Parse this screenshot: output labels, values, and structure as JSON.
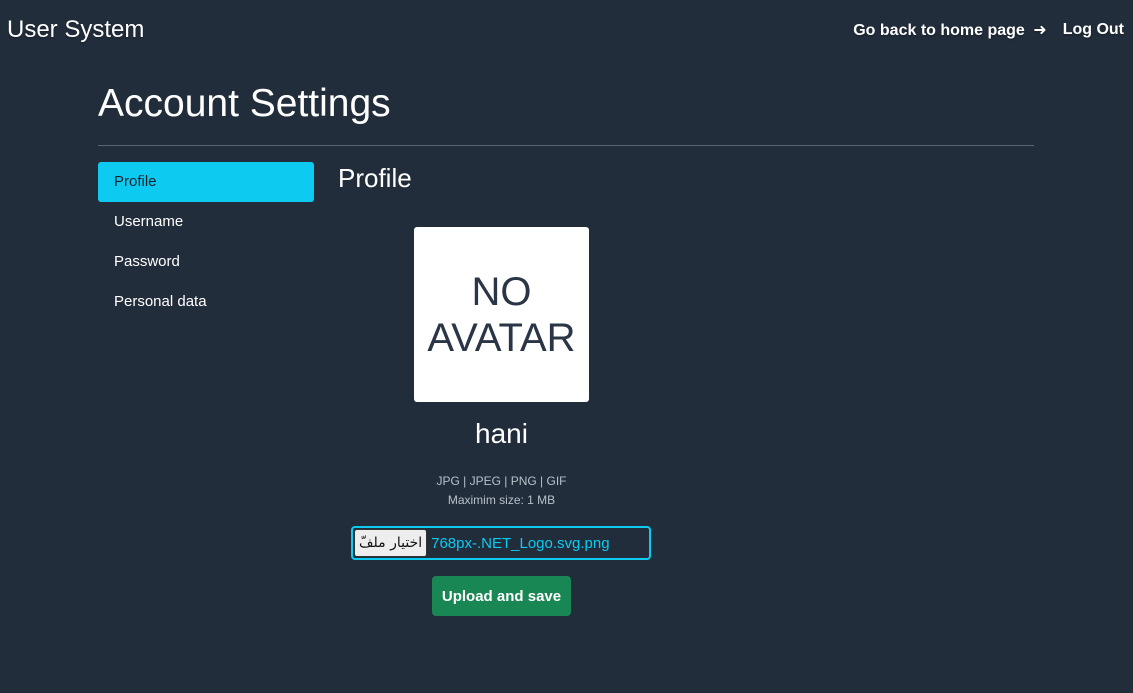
{
  "header": {
    "brand": "User System",
    "home_link": "Go back to home page",
    "home_arrow": "➜",
    "logout": "Log Out"
  },
  "page": {
    "title": "Account Settings"
  },
  "sidebar": {
    "items": [
      {
        "label": "Profile",
        "active": true
      },
      {
        "label": "Username",
        "active": false
      },
      {
        "label": "Password",
        "active": false
      },
      {
        "label": "Personal data",
        "active": false
      }
    ]
  },
  "profile": {
    "section_title": "Profile",
    "avatar_line1": "NO",
    "avatar_line2": "AVATAR",
    "username": "hani",
    "formats_hint": "JPG | JPEG | PNG | GIF",
    "size_hint": "Maximim size: 1 MB",
    "file_button_label": "اختيار ملفّ",
    "file_name": "768px-.NET_Logo.svg.png",
    "upload_button": "Upload and save"
  },
  "colors": {
    "background": "#222d3b",
    "accent": "#0dcaf0",
    "success": "#198754"
  }
}
